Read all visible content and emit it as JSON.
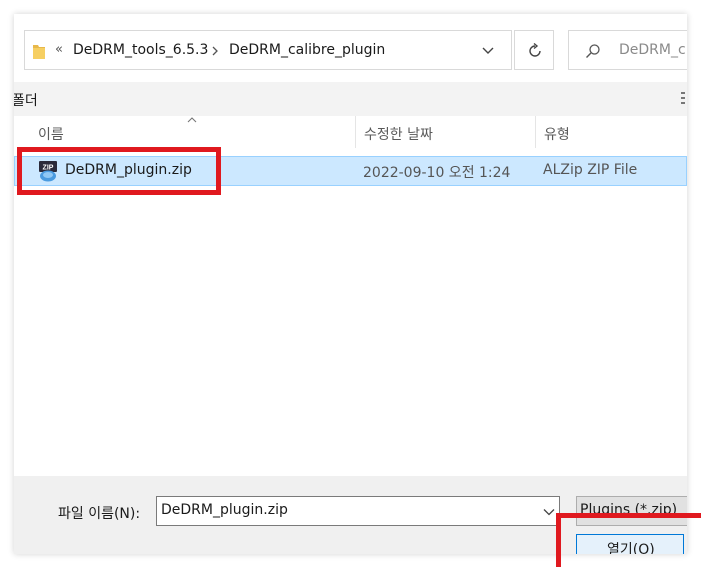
{
  "address_bar": {
    "overflow_marker": "«",
    "crumbs": [
      "DeDRM_tools_6.5.3",
      "DeDRM_calibre_plugin"
    ]
  },
  "search": {
    "placeholder": "DeDRM_c"
  },
  "toolbar": {
    "new_folder_label": "폴더"
  },
  "columns": {
    "name": "이름",
    "date": "수정한 날짜",
    "type": "유형"
  },
  "files": [
    {
      "name": "DeDRM_plugin.zip",
      "date": "2022-09-10 오전 1:24",
      "type": "ALZip ZIP File",
      "icon": "zip-icon",
      "selected": true
    }
  ],
  "file_name": {
    "label": "파일 이름(N):",
    "value": "DeDRM_plugin.zip"
  },
  "file_type_filter": {
    "value": "Plugins (*.zip)"
  },
  "open_button": {
    "label": "열기(O)"
  },
  "colors": {
    "selection": "#cce8ff",
    "selection_border": "#99d1ff",
    "annotation": "#e0191f",
    "accent": "#0078d7"
  }
}
